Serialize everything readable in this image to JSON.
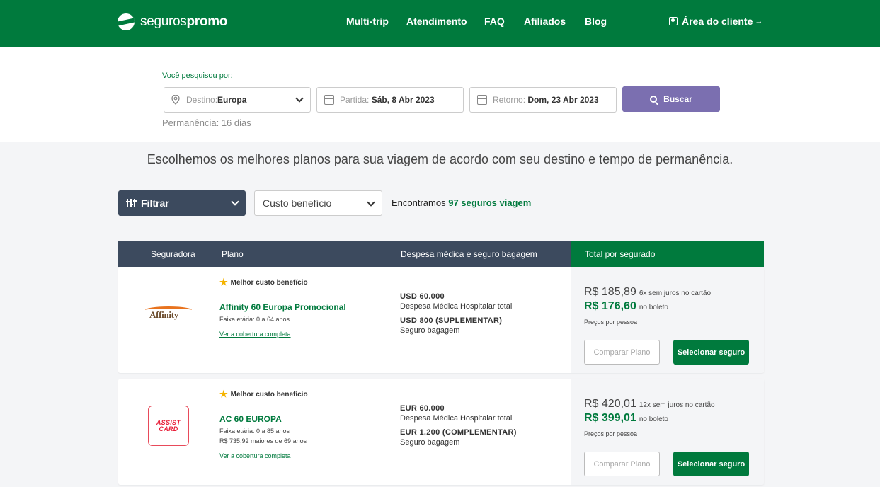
{
  "header": {
    "logo": {
      "light": "seguros",
      "bold": "promo"
    },
    "nav": [
      "Multi-trip",
      "Atendimento",
      "FAQ",
      "Afiliados",
      "Blog"
    ],
    "client_area": "Área do cliente",
    "client_arrow": "→"
  },
  "search": {
    "label": "Você pesquisou por:",
    "destination": {
      "prefix": "Destino:",
      "value": "Europa"
    },
    "departure": {
      "prefix": "Partida:",
      "value": "Sáb, 8 Abr 2023"
    },
    "return": {
      "prefix": "Retorno:",
      "value": "Dom, 23 Abr 2023"
    },
    "button": "Buscar",
    "stay": "Permanência: 16 dias"
  },
  "headline": "Escolhemos os melhores planos para sua viagem de acordo com seu destino e tempo de permanência.",
  "toolbar": {
    "filter": "Filtrar",
    "sort": "Custo benefício",
    "found_prefix": "Encontramos",
    "found_count": "97 seguros viagem"
  },
  "table_header": [
    "Seguradora",
    "Plano",
    "Despesa médica e seguro bagagem",
    "Total por segurado"
  ],
  "plans": [
    {
      "insurer": "Affinity",
      "badge": "Melhor custo benefício",
      "name": "Affinity 60 Europa Promocional",
      "age_range": "Faixa etária: 0 a 64 anos",
      "extra": "",
      "link": "Ver a cobertura completa",
      "medical_value": "USD 60.000",
      "medical_label": "Despesa Médica Hospitalar total",
      "baggage_value": "USD 800 (SUPLEMENTAR)",
      "baggage_label": "Seguro bagagem",
      "price_card": "R$ 185,89",
      "price_card_note": "6x sem juros no cartão",
      "price_boleto": "R$ 176,60",
      "price_boleto_note": "no boleto",
      "per_person": "Preços por pessoa",
      "compare": "Comparar Plano",
      "select": "Selecionar seguro"
    },
    {
      "insurer_line1": "ASSIST",
      "insurer_line2": "CARD",
      "badge": "Melhor custo benefício",
      "name": "AC 60 EUROPA",
      "age_range": "Faixa etária: 0 a 85 anos",
      "extra": "R$ 735,92 maiores de 69 anos",
      "link": "Ver a cobertura completa",
      "medical_value": "EUR 60.000",
      "medical_label": "Despesa Médica Hospitalar total",
      "baggage_value": "EUR 1.200 (COMPLEMENTAR)",
      "baggage_label": "Seguro bagagem",
      "price_card": "R$ 420,01",
      "price_card_note": "12x sem juros no cartão",
      "price_boleto": "R$ 399,01",
      "price_boleto_note": "no boleto",
      "per_person": "Preços por pessoa",
      "compare": "Comparar Plano",
      "select": "Selecionar seguro"
    }
  ],
  "colors": {
    "brand_green": "#007a3d",
    "navy": "#3c4a5e",
    "purple": "#7b6fb0",
    "star": "#f5b400"
  }
}
